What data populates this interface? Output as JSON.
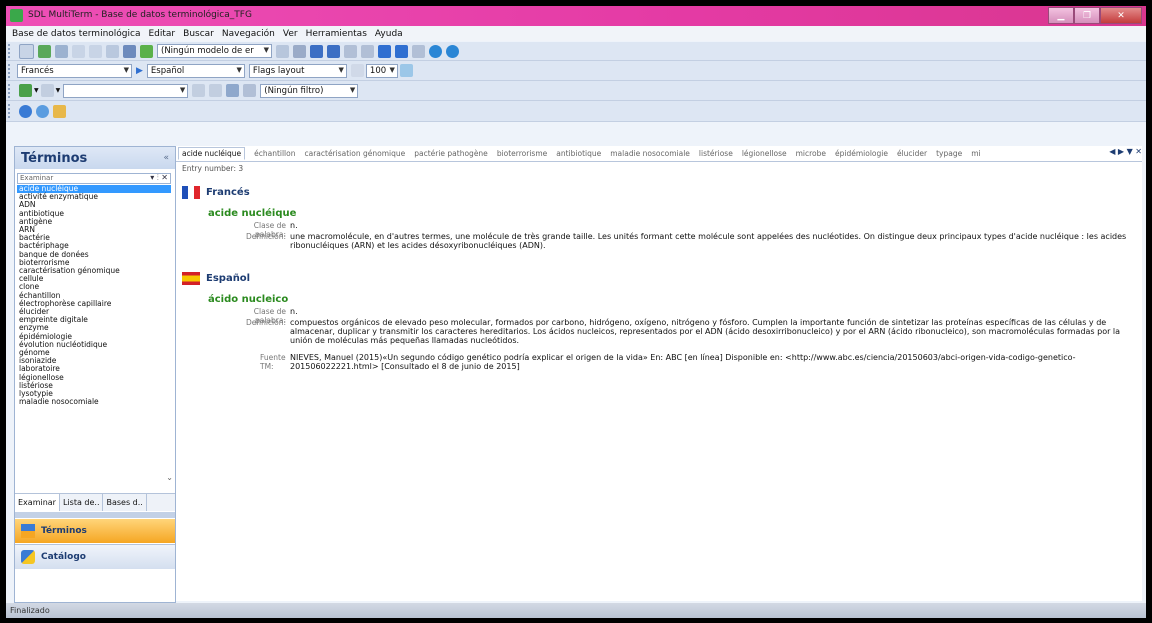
{
  "window": {
    "title": "SDL MultiTerm - Base de datos terminológica_TFG"
  },
  "menu": [
    "Base de datos terminológica",
    "Editar",
    "Buscar",
    "Navegación",
    "Ver",
    "Herramientas",
    "Ayuda"
  ],
  "toolbar1": {
    "model_combo": "(Ningún modelo de er"
  },
  "toolbar2": {
    "source_lang": "Francés",
    "target_lang": "Español",
    "layout": "Flags layout",
    "zoom": "100"
  },
  "toolbar3": {
    "filter": "(Ningún filtro)"
  },
  "sidebar": {
    "title": "Términos",
    "collapse": "«",
    "search_placeholder": "Examinar",
    "terms": [
      "acide nucléique",
      "activité enzymatique",
      "ADN",
      "antibiotique",
      "antigène",
      "ARN",
      "bactérie",
      "bactériphage",
      "banque de donées",
      "bioterrorisme",
      "caractérisation génomique",
      "cellule",
      "clone",
      "échantillon",
      "électrophorèse capillaire",
      "élucider",
      "empreinte digitale",
      "enzyme",
      "épidémiologie",
      "évolution nucléotidique",
      "génome",
      "isoniazide",
      "laboratoire",
      "légionellose",
      "listériose",
      "lysotypie",
      "maladie nosocomiale"
    ],
    "tabs": [
      "Examinar",
      "Lista de..",
      "Bases d.."
    ],
    "nav": [
      "Términos",
      "Catálogo"
    ]
  },
  "entry_tabs": [
    "acide nucléique",
    "échantillon",
    "caractérisation génomique",
    "pactérie pathogène",
    "bioterrorisme",
    "antibiotique",
    "maladie nosocomiale",
    "listériose",
    "légionellose",
    "microbe",
    "épidémiologie",
    "élucider",
    "typage",
    "mi"
  ],
  "entry": {
    "number_label": "Entry number:",
    "number": "3",
    "french": {
      "lang": "Francés",
      "term": "acide nucléique",
      "pos_label": "Clase de palabra:",
      "pos": "n.",
      "def_label": "Definición:",
      "definition": "une macromolécule, en d'autres termes, une molécule de très grande taille. Les unités formant cette molécule sont appelées des nucléotides. On distingue deux principaux types d'acide nucléique : les acides ribonucléiques (ARN) et les acides désoxyribonucléiques (ADN)."
    },
    "spanish": {
      "lang": "Español",
      "term": "ácido nucleico",
      "pos_label": "Clase de palabra:",
      "pos": "n.",
      "def_label": "Definición:",
      "definition": "compuestos orgánicos de elevado peso molecular, formados por carbono, hidrógeno, oxígeno, nitrógeno y fósforo. Cumplen la importante función de sintetizar las proteínas específicas de las células y de almacenar, duplicar y transmitir los caracteres hereditarios. Los ácidos nucleicos, representados por el ADN (ácido desoxirribonucleico) y por el ARN (ácido ribonucleico), son macromoléculas formadas por la unión de moléculas más pequeñas llamadas nucleótidos.",
      "source_label": "Fuente TM:",
      "source": "NIEVES, Manuel (2015)«Un segundo código genético podría explicar el origen de la vida» En: ABC [en línea] Disponible en: <http://www.abc.es/ciencia/20150603/abci-origen-vida-codigo-genetico-201506022221.html> [Consultado el 8 de junio de 2015]"
    }
  },
  "status": "Finalizado"
}
